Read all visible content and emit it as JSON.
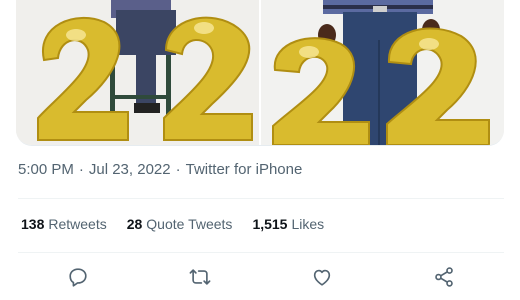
{
  "tweet": {
    "media": [
      {
        "alt_label": "",
        "balloon_text": "22"
      },
      {
        "alt_label": "",
        "balloon_text": "22"
      }
    ],
    "time": "5:00 PM",
    "separator_1": "·",
    "date": "Jul 23, 2022",
    "separator_2": "·",
    "source": "Twitter for iPhone",
    "stats": {
      "retweets_count": "138",
      "retweets_label": "Retweets",
      "quotes_count": "28",
      "quotes_label": "Quote Tweets",
      "likes_count": "1,515",
      "likes_label": "Likes"
    },
    "actions": [
      {
        "name": "reply",
        "icon": "reply-icon"
      },
      {
        "name": "retweet",
        "icon": "retweet-icon"
      },
      {
        "name": "like",
        "icon": "heart-icon"
      },
      {
        "name": "share",
        "icon": "share-icon"
      }
    ]
  },
  "colors": {
    "text_secondary": "#536471",
    "text_primary": "#0f1419",
    "divider": "#eff3f4",
    "balloon_gold": "#d4b431"
  }
}
